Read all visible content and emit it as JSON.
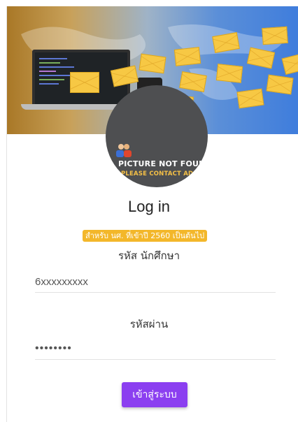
{
  "login": {
    "title": "Log in",
    "notice_badge": "สำหรับ นศ. ที่เข้าปี 2560 เป็นต้นไป",
    "student_id_label": "รหัส นักศึกษา",
    "student_id_value": "6xxxxxxxxx",
    "password_label": "รหัสผ่าน",
    "password_value": "password",
    "submit_label": "เข้าสู่ระบบ"
  },
  "avatar": {
    "line1": "PICTURE NOT FOUND",
    "line2": "PLEASE CONTACT ADMIN"
  },
  "colors": {
    "accent": "#8b3ff0",
    "badge": "#f3b72a",
    "avatar_bg": "#4e4f51"
  }
}
